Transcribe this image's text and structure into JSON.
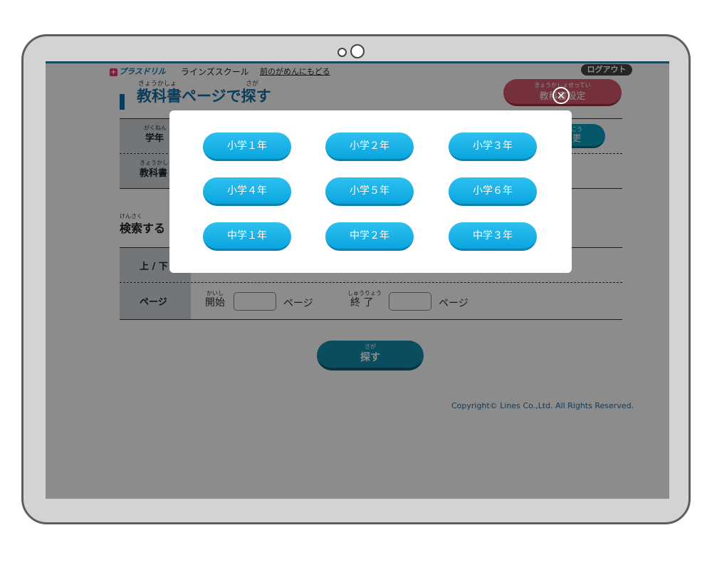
{
  "header": {
    "brand_plus": "+",
    "brand": "プラスドリル",
    "school": "ラインズスクール",
    "back_link": "前のがめんにもどる",
    "logout": "ログアウト"
  },
  "page": {
    "title_ruby_1": "きょうかしょ",
    "title_ruby_2": "さが",
    "title": "教科書ページで探す",
    "setting_ruby": "きょうかしょせってい",
    "setting_label": "教科書設定"
  },
  "rows": {
    "grade_ruby": "がくねん",
    "grade_label": "学年",
    "textbook_ruby": "きょうかしょ",
    "textbook_label": "教科書",
    "change_ruby": "こう",
    "change_label": "更"
  },
  "search": {
    "heading_ruby": "けんさく",
    "heading": "検索する",
    "updown_label": "上 / 下",
    "page_label": "ページ",
    "start_ruby": "かいし",
    "start_label": "開始",
    "page_suffix_1": "ページ",
    "end_ruby": "しゅうりょう",
    "end_label": "終 了",
    "page_suffix_2": "ページ",
    "start_value": "",
    "end_value": "",
    "search_ruby": "さが",
    "search_label": "探す"
  },
  "footer": {
    "copyright": "Copyright© Lines Co.,Ltd. All Rights Reserved."
  },
  "modal": {
    "grades": [
      "小学１年",
      "小学２年",
      "小学３年",
      "小学４年",
      "小学５年",
      "小学６年",
      "中学１年",
      "中学２年",
      "中学３年"
    ],
    "close_symbol": "×"
  },
  "colors": {
    "accent_blue": "#136fa6",
    "grade_button": "#0aa5df",
    "setting_pink": "#d4596d"
  }
}
